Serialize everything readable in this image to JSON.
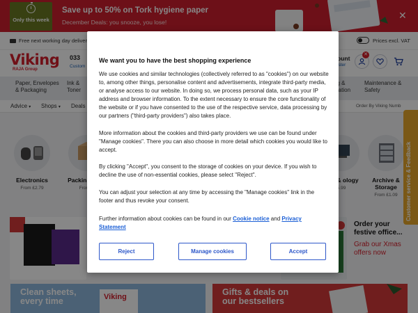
{
  "promo_banner": {
    "badge_text": "Only this week",
    "title": "Save up to 50% on Tork hygiene paper",
    "subtitle": "December Deals: you snooze, you lose!",
    "close_symbol": "✕"
  },
  "utility_bar": {
    "delivery_text": "Free next working day delivery*",
    "vat_label": "Prices excl. VAT"
  },
  "header": {
    "logo_text": "Viking",
    "logo_subtext": "RAJA Group",
    "phone_partial": "033",
    "phone_sub_partial": "Custom",
    "account_partial": "ount",
    "account_sub_partial": "ister"
  },
  "category_nav": {
    "items": [
      "Paper, Envelopes & Packaging",
      "Ink & Toner",
      "ng & ntation",
      "Maintenance & Safety"
    ]
  },
  "sub_nav": {
    "items": [
      "Advice",
      "Shops",
      "Deals"
    ],
    "right_text": "Order By Viking Numb"
  },
  "categories": [
    {
      "name": "Electronics",
      "price": "From £2.79"
    },
    {
      "name": "Packin Mailin",
      "price": "From £"
    },
    {
      "name": "ters & ology",
      "price": "5.99"
    },
    {
      "name": "Archive & Storage",
      "price": "From £1.09"
    }
  ],
  "xmas_promo": {
    "title": "Order your festive office...",
    "link": "Grab our Xmas offers now"
  },
  "bottom_cards": [
    {
      "title": "Clean sheets, every time"
    },
    {
      "title": "Gifts & deals on our bestsellers"
    }
  ],
  "feedback_tab": "Customer service & Feedback",
  "cookie_modal": {
    "title": "We want you to have the best shopping experience",
    "paragraph_1": "We use cookies and similar technologies (collectively referred to as \"cookies\") on our website to, among other things, personalise content and advertisements, integrate third-party media, or analyse access to our website. In doing so, we process personal data, such as your IP address and browser information. To the extent necessary to ensure the core functionality of the website or if you have consented to the use of the respective service, data processing by our partners (\"third-party providers\") also takes place.",
    "paragraph_2": "More information about the cookies and third-party providers we use can be found under \"Manage cookies\". There you can also choose in more detail which cookies you would like to accept.",
    "paragraph_3": "By clicking \"Accept\", you consent to the storage of cookies on your device. If you wish to decline the use of non-essential cookies, please select \"Reject\".",
    "paragraph_4": "You can adjust your selection at any time by accessing the \"Manage cookies\" link in the footer and thus revoke your consent.",
    "paragraph_5_before": "Further information about cookies can be found in our ",
    "cookie_notice_link": "Cookie notice",
    "paragraph_5_and": " and ",
    "privacy_link": "Privacy Statement",
    "reject_label": "Reject",
    "manage_label": "Manage cookies",
    "accept_label": "Accept"
  },
  "colors": {
    "brand_red": "#d41f2c",
    "link_blue": "#1b5fd6",
    "button_blue": "#2d57c9",
    "feedback_orange": "#e6a72b"
  }
}
